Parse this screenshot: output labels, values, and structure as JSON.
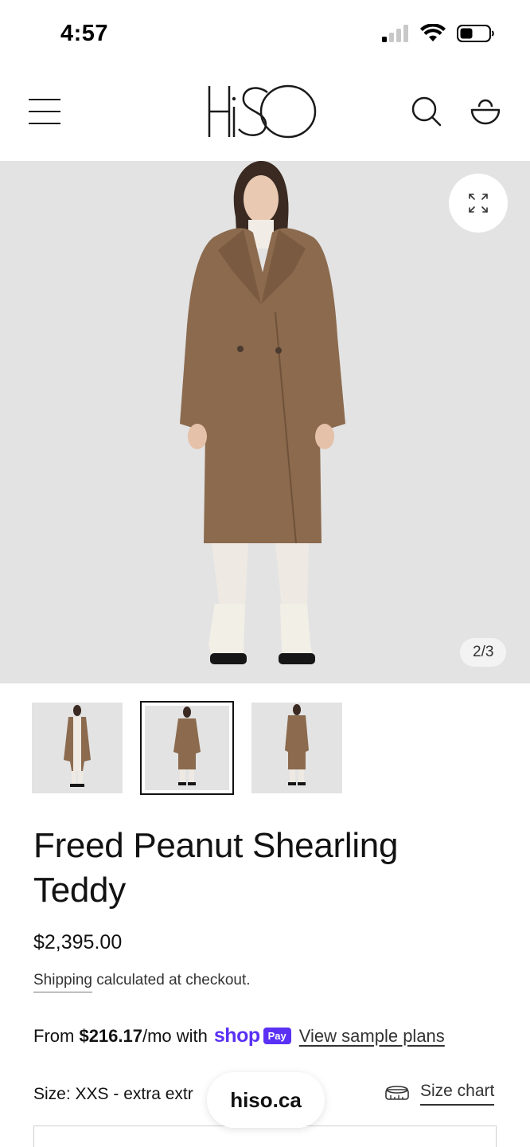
{
  "status_bar": {
    "time": "4:57"
  },
  "header": {
    "menu_icon": "hamburger-icon",
    "logo_text": "HiSO",
    "search_icon": "search-icon",
    "cart_icon": "cart-icon"
  },
  "gallery": {
    "counter": "2/3",
    "zoom_icon": "expand-icon",
    "background": "#e3e3e3",
    "coat_color": "#8b6a4e",
    "thumbnails": [
      {
        "view": "front-open"
      },
      {
        "view": "front-closed",
        "active": true
      },
      {
        "view": "back"
      }
    ]
  },
  "product": {
    "title": "Freed Peanut Shearling Teddy",
    "price": "$2,395.00",
    "shipping_link": "Shipping",
    "shipping_text": " calculated at checkout."
  },
  "installments": {
    "prefix": "From ",
    "amount": "$216.17",
    "suffix": "/mo with",
    "shop_word": "shop",
    "pay_badge": "Pay",
    "link": "View sample plans",
    "brand_color": "#5a31f4"
  },
  "size": {
    "label": "Size: XXS - extra extr",
    "chart_link": "Size chart",
    "chart_icon": "ruler-icon"
  },
  "browser": {
    "domain": "hiso.ca"
  }
}
